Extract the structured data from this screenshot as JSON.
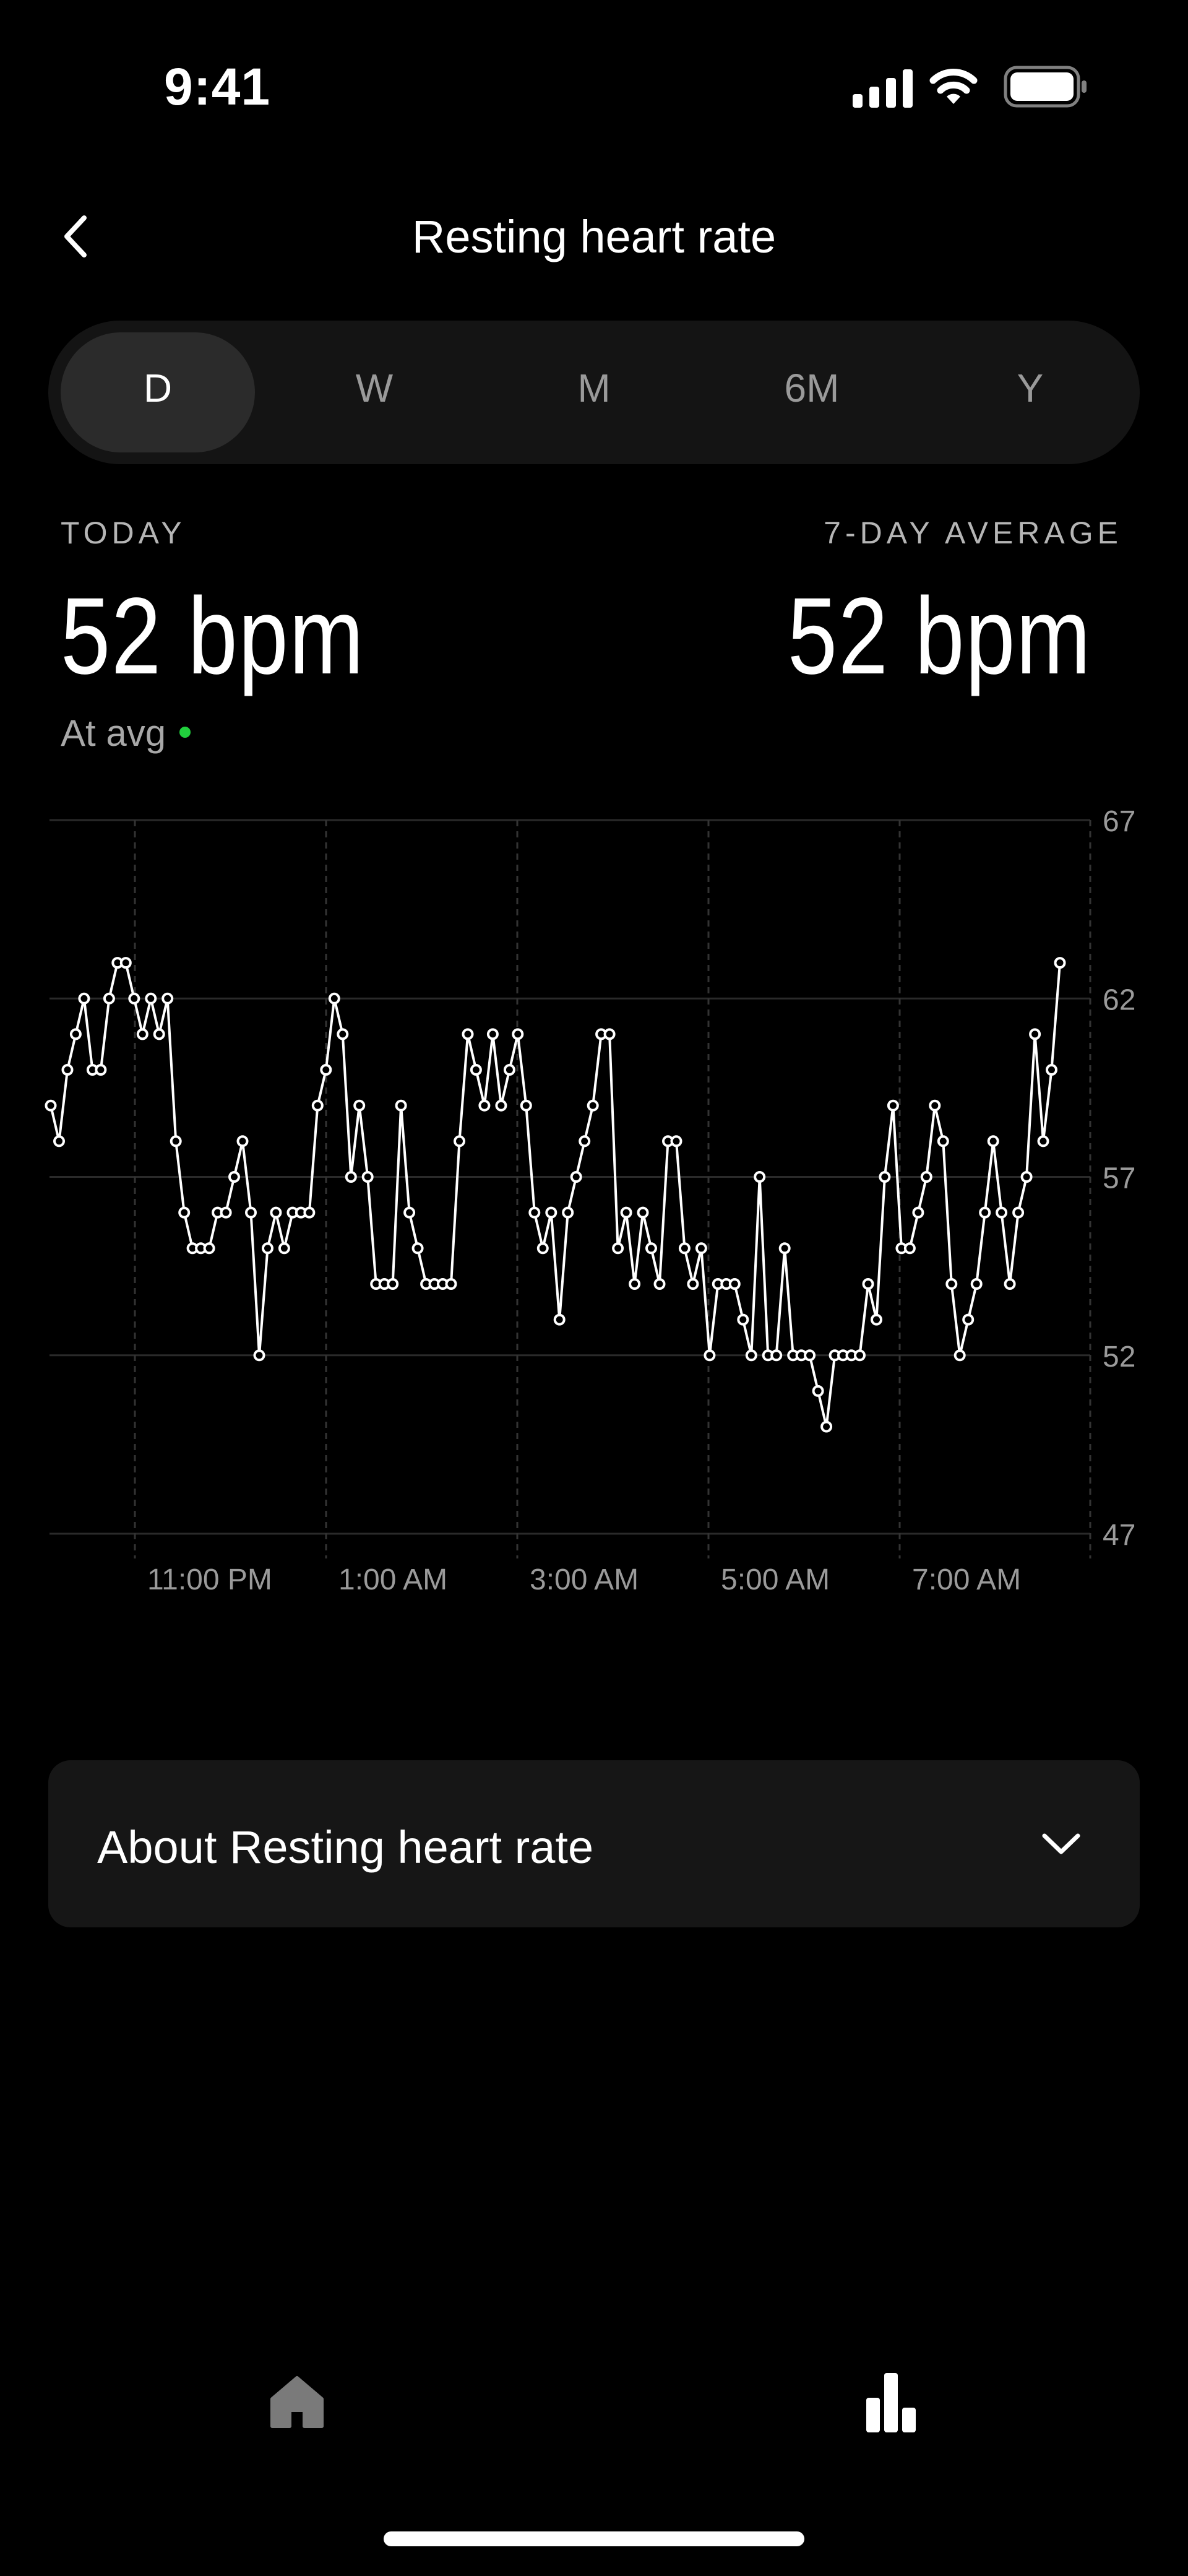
{
  "status_bar": {
    "time": "9:41"
  },
  "header": {
    "title": "Resting heart rate"
  },
  "range_tabs": [
    {
      "label": "D",
      "selected": true
    },
    {
      "label": "W",
      "selected": false
    },
    {
      "label": "M",
      "selected": false
    },
    {
      "label": "6M",
      "selected": false
    },
    {
      "label": "Y",
      "selected": false
    }
  ],
  "stats": {
    "today": {
      "label": "TODAY",
      "value": "52 bpm",
      "note": "At avg",
      "note_color": "#21d13d"
    },
    "seven_day": {
      "label": "7-DAY AVERAGE",
      "value": "52 bpm"
    }
  },
  "chart_data": {
    "type": "line",
    "title": "",
    "xlabel": "",
    "ylabel": "",
    "ylim": [
      47,
      67
    ],
    "y_ticks": [
      "67",
      "62",
      "57",
      "52",
      "47"
    ],
    "x_tick_labels": [
      "11:00 PM",
      "1:00 AM",
      "3:00 AM",
      "5:00 AM",
      "7:00 AM"
    ],
    "grid": true,
    "line_color": "#ffffff",
    "series": [
      {
        "values": [
          59,
          58,
          60,
          61,
          62,
          60,
          60,
          62,
          63,
          63,
          62,
          61,
          62,
          61,
          62,
          58,
          56,
          55,
          55,
          55,
          56,
          56,
          57,
          58,
          56,
          52,
          55,
          56,
          55,
          56,
          56,
          56,
          59,
          60,
          62,
          61,
          57,
          59,
          57,
          54,
          54,
          54,
          59,
          56,
          55,
          54,
          54,
          54,
          54,
          58,
          61,
          60,
          59,
          61,
          59,
          60,
          61,
          59,
          56,
          55,
          56,
          53,
          56,
          57,
          58,
          59,
          61,
          61,
          55,
          56,
          54,
          56,
          55,
          54,
          58,
          58,
          55,
          54,
          55,
          52,
          54,
          54,
          54,
          53,
          52,
          57,
          52,
          52,
          55,
          52,
          52,
          52,
          51,
          50,
          52,
          52,
          52,
          52,
          54,
          53,
          57,
          59,
          55,
          55,
          56,
          57,
          59,
          58,
          54,
          52,
          53,
          54,
          56,
          58,
          56,
          54,
          56,
          57,
          61,
          58,
          60,
          63
        ]
      }
    ]
  },
  "about": {
    "label": "About Resting heart rate"
  }
}
